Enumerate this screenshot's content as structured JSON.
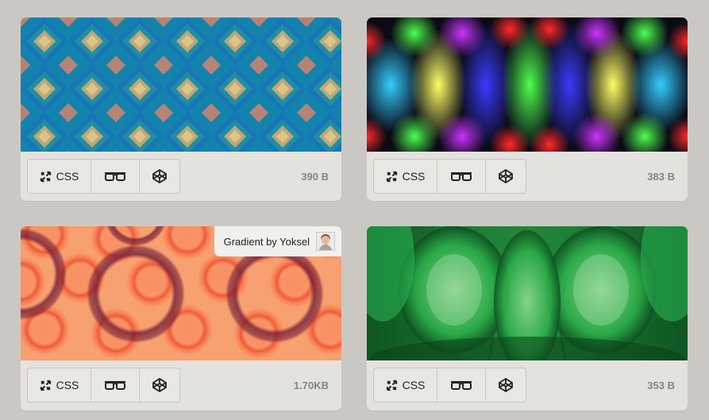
{
  "cards": [
    {
      "css_label": "CSS",
      "size": "390 B"
    },
    {
      "css_label": "CSS",
      "size": "383 B"
    },
    {
      "css_label": "CSS",
      "size": "1.70KB",
      "credit": "Gradient by Yoksel"
    },
    {
      "css_label": "CSS",
      "size": "353 B"
    }
  ],
  "icons": {
    "css": "expand-arrows-icon",
    "view": "glasses-icon",
    "codepen": "codepen-icon",
    "author": "author-avatar"
  },
  "colors": {
    "background": "#cbc8c3",
    "card": "#e4e2df",
    "size_text": "#868480"
  }
}
